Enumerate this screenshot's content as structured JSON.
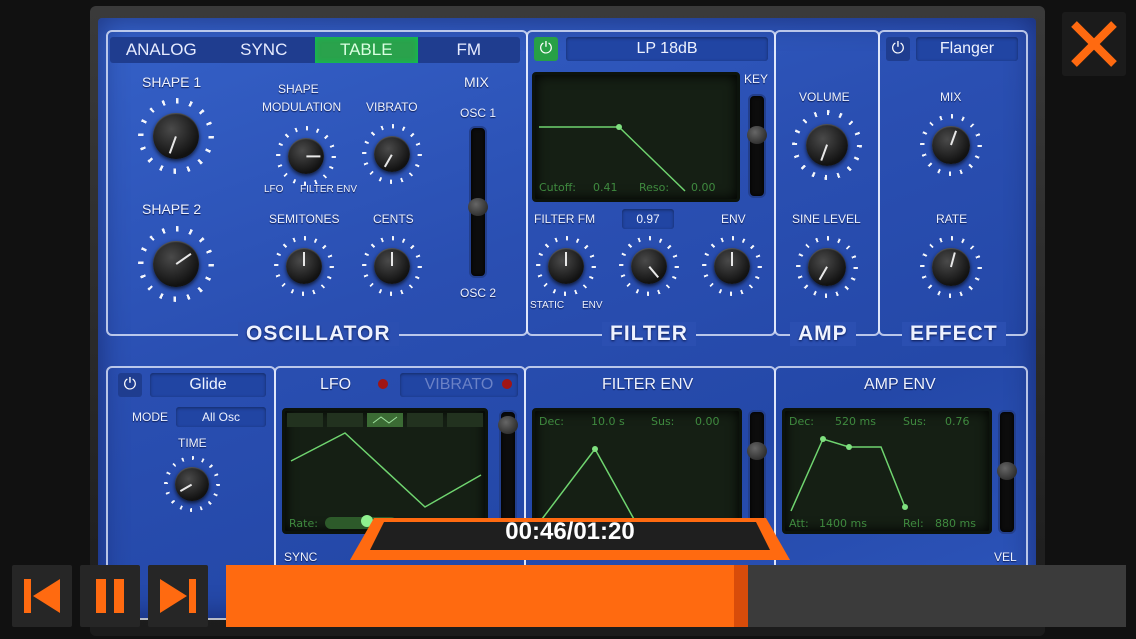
{
  "osc": {
    "tabs": [
      "ANALOG",
      "SYNC",
      "TABLE",
      "FM"
    ],
    "active_tab": "TABLE",
    "shape1": "SHAPE 1",
    "shape2": "SHAPE 2",
    "shape_mod": "SHAPE",
    "shape_mod2": "MODULATION",
    "vibrato": "VIBRATO",
    "lfo": "LFO",
    "filter_env": "FILTER ENV",
    "semitones": "SEMITONES",
    "cents": "CENTS",
    "mix": "MIX",
    "osc1": "OSC 1",
    "osc2": "OSC 2",
    "title": "OSCILLATOR"
  },
  "filter": {
    "type": "LP 18dB",
    "key": "KEY",
    "cutoff_label": "Cutoff:",
    "cutoff": "0.41",
    "reso_label": "Reso:",
    "reso": "0.00",
    "fm": "FILTER FM",
    "fm_value": "0.97",
    "env": "ENV",
    "static": "STATIC",
    "env2": "ENV",
    "title": "FILTER"
  },
  "amp": {
    "volume": "VOLUME",
    "sine": "SINE LEVEL",
    "title": "AMP"
  },
  "effect": {
    "name": "Flanger",
    "mix": "MIX",
    "rate": "RATE",
    "title": "EFFECT"
  },
  "glide": {
    "name": "Glide",
    "mode_label": "MODE",
    "mode": "All Osc",
    "time": "TIME"
  },
  "lfo": {
    "title": "LFO",
    "vibrato": "VIBRATO",
    "rate": "Rate:",
    "sync": "SYNC"
  },
  "fenv": {
    "title": "FILTER ENV",
    "dec_label": "Dec:",
    "dec": "10.0 s",
    "sus_label": "Sus:",
    "sus": "0.00"
  },
  "aenv": {
    "title": "AMP ENV",
    "dec_label": "Dec:",
    "dec": "520 ms",
    "sus_label": "Sus:",
    "sus": "0.76",
    "att_label": "Att:",
    "att": "1400 ms",
    "rel_label": "Rel:",
    "rel": "880 ms",
    "vel": "VEL"
  },
  "player": {
    "time": "00:46/01:20",
    "progress": 0.58
  },
  "colors": {
    "accent": "#ff6a10",
    "panel": "#2b4fb1",
    "screen_line": "#6fd46f"
  }
}
